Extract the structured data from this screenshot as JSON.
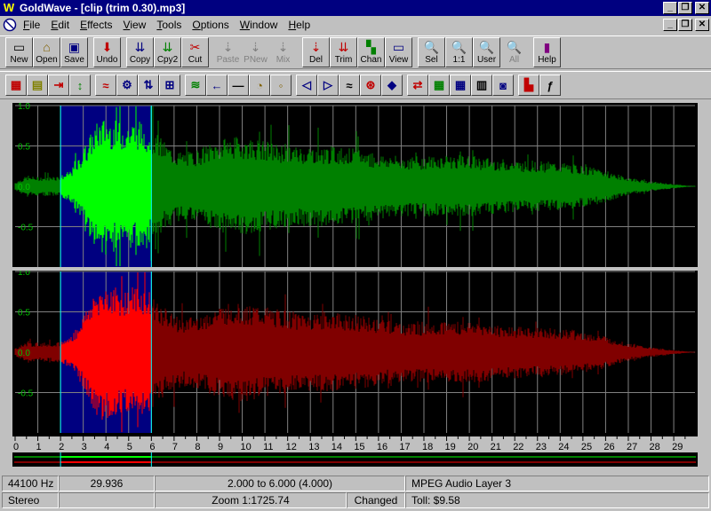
{
  "window": {
    "title": "GoldWave - [clip (trim 0.30).mp3]",
    "title_controls": [
      "_",
      "❐",
      "✕"
    ]
  },
  "menu": {
    "items": [
      {
        "label": "File",
        "key": "F",
        "rest": "ile"
      },
      {
        "label": "Edit",
        "key": "E",
        "rest": "dit"
      },
      {
        "label": "Effects",
        "key": "E",
        "rest": "ffects"
      },
      {
        "label": "View",
        "key": "V",
        "rest": "iew"
      },
      {
        "label": "Tools",
        "key": "T",
        "rest": "ools"
      },
      {
        "label": "Options",
        "key": "O",
        "rest": "ptions"
      },
      {
        "label": "Window",
        "key": "W",
        "rest": "indow"
      },
      {
        "label": "Help",
        "key": "H",
        "rest": "elp"
      }
    ],
    "doc_controls": [
      "_",
      "❐",
      "✕"
    ]
  },
  "toolbar": {
    "buttons": [
      {
        "label": "New",
        "icon": "new-icon",
        "enabled": true
      },
      {
        "label": "Open",
        "icon": "open-icon",
        "enabled": true
      },
      {
        "label": "Save",
        "icon": "save-icon",
        "enabled": true
      },
      {
        "label": "Undo",
        "icon": "undo-icon",
        "enabled": true
      },
      {
        "label": "Copy",
        "icon": "copy-icon",
        "enabled": true
      },
      {
        "label": "Cpy2",
        "icon": "copy2-icon",
        "enabled": true
      },
      {
        "label": "Cut",
        "icon": "cut-icon",
        "enabled": true
      },
      {
        "label": "Paste",
        "icon": "paste-icon",
        "enabled": false
      },
      {
        "label": "PNew",
        "icon": "paste-new-icon",
        "enabled": false
      },
      {
        "label": "Mix",
        "icon": "mix-icon",
        "enabled": false
      },
      {
        "label": "Del",
        "icon": "delete-icon",
        "enabled": true
      },
      {
        "label": "Trim",
        "icon": "trim-icon",
        "enabled": true
      },
      {
        "label": "Chan",
        "icon": "channel-icon",
        "enabled": true
      },
      {
        "label": "View",
        "icon": "view-icon",
        "enabled": true
      },
      {
        "label": "Sel",
        "icon": "zoom-selection-icon",
        "enabled": true
      },
      {
        "label": "1:1",
        "icon": "zoom-1to1-icon",
        "enabled": true
      },
      {
        "label": "User",
        "icon": "zoom-user-icon",
        "enabled": true
      },
      {
        "label": "All",
        "icon": "zoom-all-icon",
        "enabled": false
      },
      {
        "label": "Help",
        "icon": "help-book-icon",
        "enabled": true
      }
    ]
  },
  "effects_toolbar": {
    "icons": [
      "spectrum-icon",
      "noise-icon",
      "doppler-icon",
      "volume-icon",
      "echo-icon",
      "equalizer-gear-icon",
      "flip-icon",
      "invert-icon",
      "mechanize-icon",
      "offset-icon",
      "reverse-icon",
      "silence-icon",
      "clock-icon",
      "pitch-icon",
      "resample-icon",
      "playback-rate-icon",
      "transpose-icon",
      "stereo-icon",
      "match-icon",
      "filter-icon",
      "bandpass-icon",
      "spectrum-bars-icon",
      "dynamic-icon",
      "marker-icon",
      "function-icon"
    ]
  },
  "waveform": {
    "y_ticks": [
      "1.0",
      "0.5",
      "0.0",
      "-0.5"
    ],
    "x_ticks": [
      "0",
      "1",
      "2",
      "3",
      "4",
      "5",
      "6",
      "7",
      "8",
      "9",
      "10",
      "11",
      "12",
      "13",
      "14",
      "15",
      "16",
      "17",
      "18",
      "19",
      "20",
      "21",
      "22",
      "23",
      "24",
      "25",
      "26",
      "27",
      "28",
      "29"
    ],
    "duration": 29.936,
    "selection_start": 2.0,
    "selection_end": 6.0,
    "colors": {
      "background": "#000000",
      "selection": "#000080",
      "grid": "#808080",
      "left_wave": "#008000",
      "left_wave_selected": "#00ff00",
      "right_wave": "#800000",
      "right_wave_selected": "#ff0000",
      "axis_text": "#00c000"
    }
  },
  "status": {
    "sample_rate": "44100 Hz",
    "length": "29.936",
    "selection": "2.000 to 6.000  (4.000)",
    "format": "MPEG Audio Layer 3",
    "channels": "Stereo",
    "blank1": "",
    "zoom": "Zoom 1:1725.74",
    "modified": "Changed",
    "toll": "Toll: $9.58"
  }
}
